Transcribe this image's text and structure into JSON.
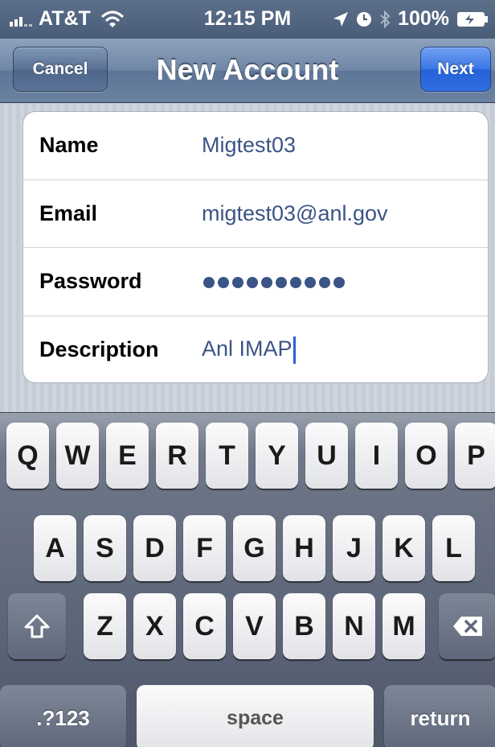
{
  "status_bar": {
    "carrier": "AT&T",
    "time": "12:15 PM",
    "battery": "100%",
    "icons": [
      "signal-icon",
      "wifi-icon",
      "location-icon",
      "alarm-icon",
      "bluetooth-icon",
      "battery-icon"
    ]
  },
  "nav": {
    "title": "New Account",
    "cancel_label": "Cancel",
    "next_label": "Next"
  },
  "form": {
    "rows": [
      {
        "label": "Name",
        "value": "Migtest03"
      },
      {
        "label": "Email",
        "value": "migtest03@anl.gov"
      },
      {
        "label": "Password",
        "value_masked_length": 10
      },
      {
        "label": "Description",
        "value": "Anl IMAP"
      }
    ]
  },
  "keyboard": {
    "row1": [
      "Q",
      "W",
      "E",
      "R",
      "T",
      "Y",
      "U",
      "I",
      "O",
      "P"
    ],
    "row2": [
      "A",
      "S",
      "D",
      "F",
      "G",
      "H",
      "J",
      "K",
      "L"
    ],
    "row3": [
      "Z",
      "X",
      "C",
      "V",
      "B",
      "N",
      "M"
    ],
    "shift_icon": "shift-icon",
    "delete_icon": "delete-icon",
    "numbers_label": ".?123",
    "space_label": "space",
    "return_label": "return"
  },
  "colors": {
    "nav_blue": "#6f86a6",
    "next_blue": "#2f6ee0",
    "value_text": "#3b5486",
    "caret": "#2a60d8"
  }
}
